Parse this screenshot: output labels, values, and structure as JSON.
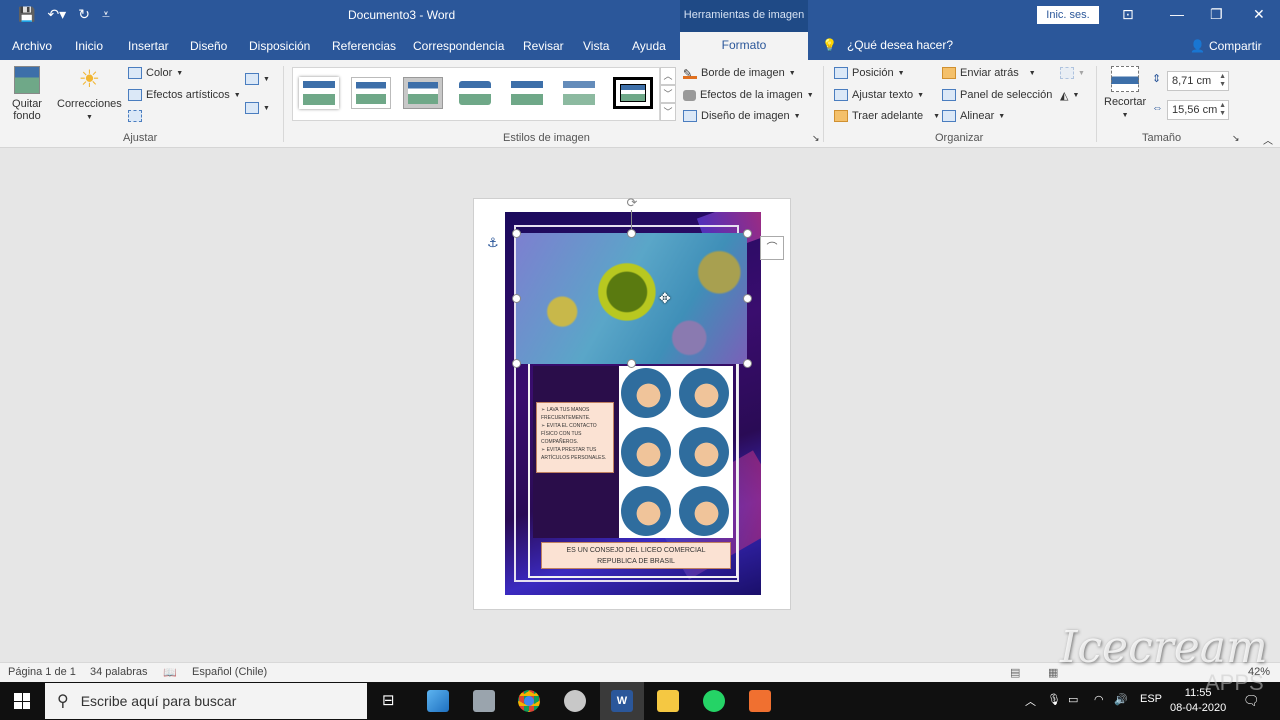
{
  "titlebar": {
    "doc_title": "Documento3  -  Word",
    "contextual_header": "Herramientas de imagen",
    "signin": "Inic. ses.",
    "qat": {
      "save": "💾",
      "undo": "↶▾",
      "redo": "↻",
      "customize": "⩡"
    },
    "window_controls": {
      "ribbon_display": "⊡",
      "minimize": "—",
      "restore": "❐",
      "close": "✕"
    }
  },
  "tabs": [
    {
      "label": "Archivo"
    },
    {
      "label": "Inicio"
    },
    {
      "label": "Insertar"
    },
    {
      "label": "Diseño"
    },
    {
      "label": "Disposición"
    },
    {
      "label": "Referencias"
    },
    {
      "label": "Correspondencia"
    },
    {
      "label": "Revisar"
    },
    {
      "label": "Vista"
    },
    {
      "label": "Ayuda"
    },
    {
      "label": "Formato",
      "active": true
    }
  ],
  "tell_me": {
    "icon": "lightbulb-icon",
    "placeholder": "¿Qué desea hacer?"
  },
  "share": {
    "label": "Compartir"
  },
  "ribbon": {
    "ajustar": {
      "label": "Ajustar",
      "remove_bg": "Quitar fondo",
      "corrections": "Correcciones",
      "color": "Color",
      "artistic": "Efectos artísticos"
    },
    "estilos": {
      "label": "Estilos de imagen",
      "thumb_count": 7,
      "selected_index": 6,
      "border": "Borde de imagen",
      "effects": "Efectos de la imagen",
      "layout": "Diseño de imagen"
    },
    "organizar": {
      "label": "Organizar",
      "position": "Posición",
      "wrap": "Ajustar texto",
      "bring_forward": "Traer adelante",
      "send_back": "Enviar atrás",
      "selection_pane": "Panel de selección",
      "align": "Alinear"
    },
    "tamano": {
      "label": "Tamaño",
      "crop": "Recortar",
      "height": "8,71 cm",
      "width": "15,56 cm"
    }
  },
  "document": {
    "tips": [
      "LAVA TUS MANOS FRECUENTEMENTE.",
      "EVITA EL CONTACTO FÍSICO CON TUS COMPAÑEROS.",
      "EVITA PRESTAR TUS ARTÍCULOS PERSONALES."
    ],
    "footer_line1": "ES UN CONSEJO DEL LICEO COMERCIAL",
    "footer_line2": "REPUBLICA DE BRASIL"
  },
  "statusbar": {
    "page": "Página 1 de 1",
    "words": "34 palabras",
    "language": "Español (Chile)",
    "zoom": "42%"
  },
  "taskbar": {
    "search_placeholder": "Escribe aquí para buscar",
    "lang": "ESP",
    "time": "11:55",
    "date": "08-04-2020"
  },
  "watermark": {
    "text": "Icecream",
    "sub": "APPS"
  }
}
